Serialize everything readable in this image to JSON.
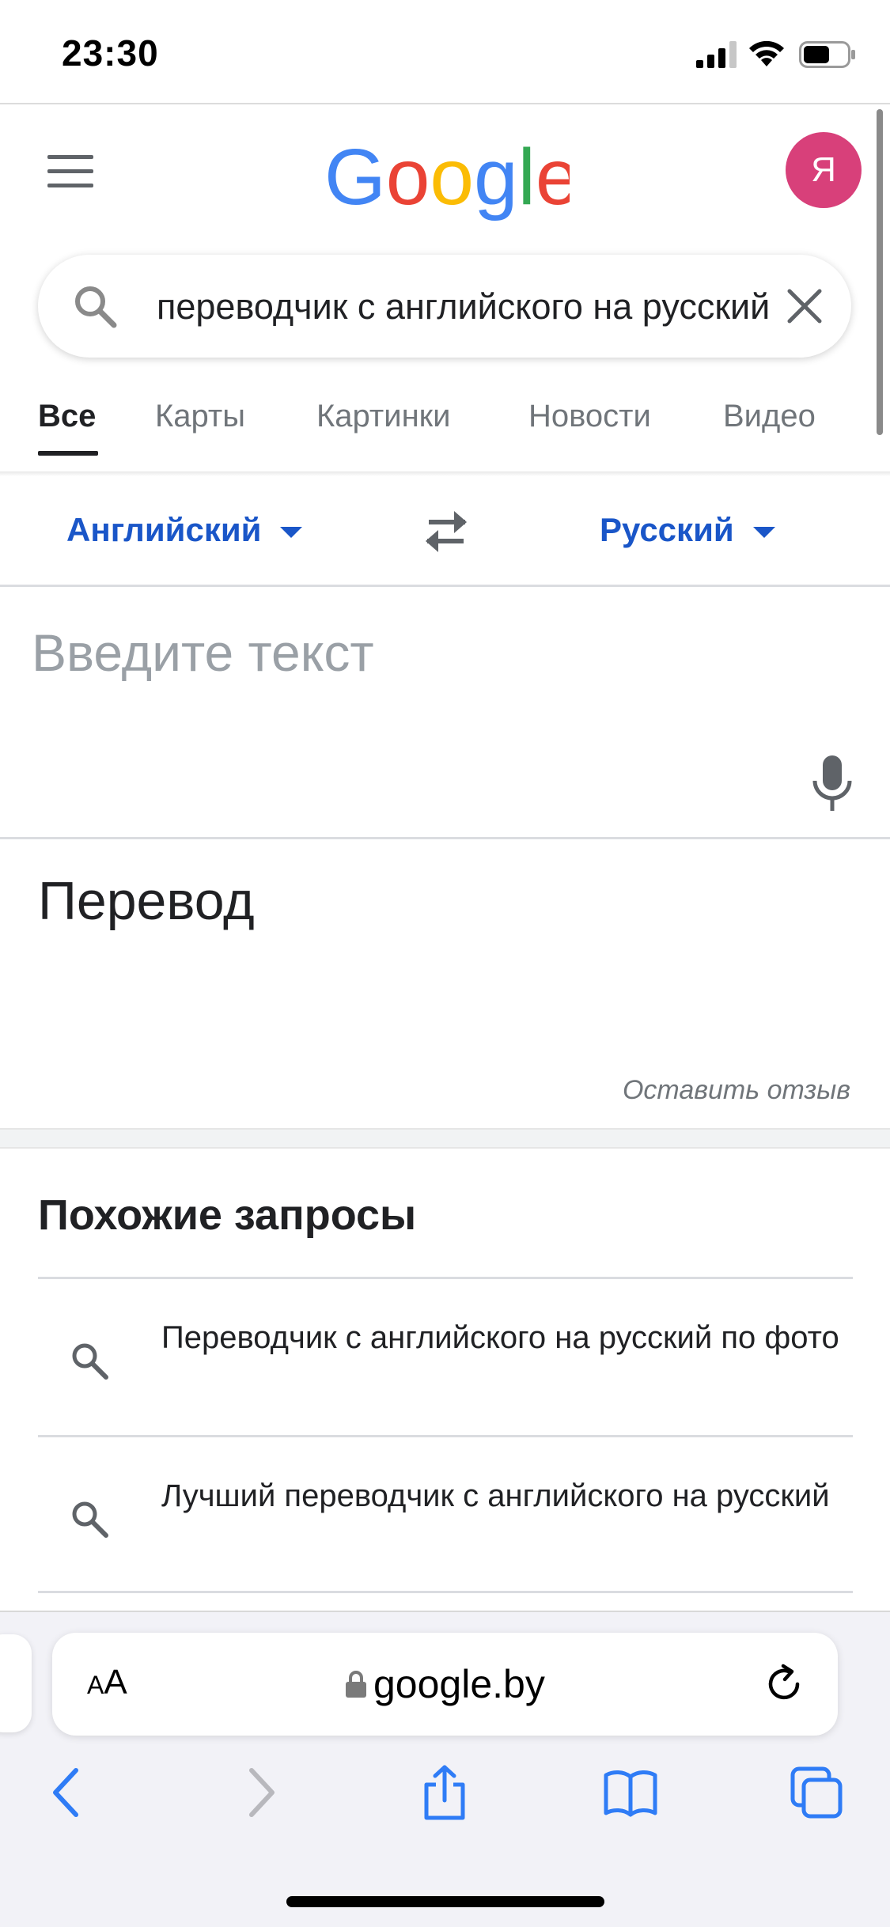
{
  "status_bar": {
    "time": "23:30"
  },
  "header": {
    "logo": "Google",
    "avatar_letter": "Я"
  },
  "search": {
    "query": "переводчик с английского на русский"
  },
  "tabs": [
    {
      "label": "Все"
    },
    {
      "label": "Карты"
    },
    {
      "label": "Картинки"
    },
    {
      "label": "Новости"
    },
    {
      "label": "Видео"
    }
  ],
  "translator": {
    "source_lang": "Английский",
    "target_lang": "Русский",
    "input_placeholder": "Введите текст",
    "output_placeholder": "Перевод",
    "feedback_link": "Оставить отзыв"
  },
  "related": {
    "title": "Похожие запросы",
    "items": [
      {
        "text": "Переводчик с английского на русский по фото"
      },
      {
        "text": "Лучший переводчик с английского на русский"
      }
    ]
  },
  "safari": {
    "aa_small": "A",
    "aa_large": "A",
    "url": "google.by"
  },
  "colors": {
    "accent_blue": "#1a56c8",
    "avatar_bg": "#d8407a",
    "safari_blue": "#2f7cf6"
  }
}
